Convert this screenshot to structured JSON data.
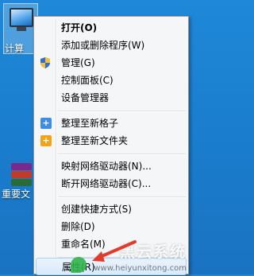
{
  "desktop": {
    "icons": [
      {
        "label": "计算",
        "icon": "computer-icon"
      },
      {
        "label": "重要文",
        "icon": "winrar-archive-icon"
      }
    ]
  },
  "context_menu": {
    "items": [
      {
        "label": "打开(O)",
        "bold": true
      },
      {
        "label": "添加或删除程序(W)"
      },
      {
        "label": "管理(G)",
        "icon": "uac-shield-icon"
      },
      {
        "label": "控制面板(C)"
      },
      {
        "label": "设备管理器"
      },
      {
        "label": "整理至新格子",
        "icon": "fences-plus-icon"
      },
      {
        "label": "整理至新文件夹",
        "icon": "fences-folder-plus-icon"
      },
      {
        "label": "映射网络驱动器(N)..."
      },
      {
        "label": "断开网络驱动器(C)..."
      },
      {
        "label": "创建快捷方式(S)"
      },
      {
        "label": "删除(D)"
      },
      {
        "label": "重命名(M)"
      },
      {
        "label": "属性(R)",
        "hovered": true
      }
    ]
  },
  "watermark": {
    "title": "黑云系统",
    "url": "www.heiyunxitong.com"
  },
  "colors": {
    "desktop": "#1f88d8",
    "menu_bg": "#f5f6f7",
    "hover_border": "#a8d1f5",
    "arrow": "#e23b2b"
  }
}
